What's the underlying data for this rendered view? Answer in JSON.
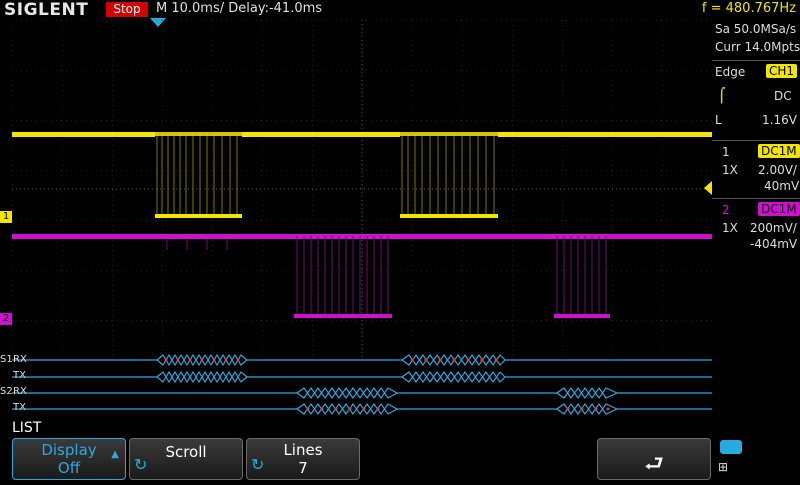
{
  "header": {
    "brand": "SIGLENT",
    "run_state": "Stop",
    "timebase": "M 10.0ms/ Delay:-41.0ms",
    "frequency": "f = 480.767Hz"
  },
  "acquisition": {
    "sample_rate": "Sa 50.0MSa/s",
    "memory": "Curr 14.0Mpts"
  },
  "trigger": {
    "type": "Edge",
    "source": "CH1",
    "coupling": "DC",
    "level_label": "L",
    "level": "1.16V"
  },
  "channel1": {
    "number": "1",
    "coupling": "DC1M",
    "probe": "1X",
    "scale": "2.00V/",
    "offset": "40mV"
  },
  "channel2": {
    "number": "2",
    "coupling": "DC1M",
    "probe": "1X",
    "scale": "200mV/",
    "offset": "-404mV"
  },
  "bus": {
    "s1": {
      "name": "S1",
      "rx": "RX",
      "tx": "TX"
    },
    "s2": {
      "name": "S2",
      "rx": "RX",
      "tx": "TX"
    }
  },
  "menu": {
    "title": "LIST",
    "display_label": "Display",
    "display_value": "Off",
    "scroll_label": "Scroll",
    "lines_label": "Lines",
    "lines_value": "7"
  },
  "markers": {
    "ch1": "1",
    "ch2": "2"
  },
  "colors": {
    "ch1": "#f2e600",
    "ch2": "#d010d0",
    "accent": "#2aa9e0",
    "stop": "#d40000"
  }
}
